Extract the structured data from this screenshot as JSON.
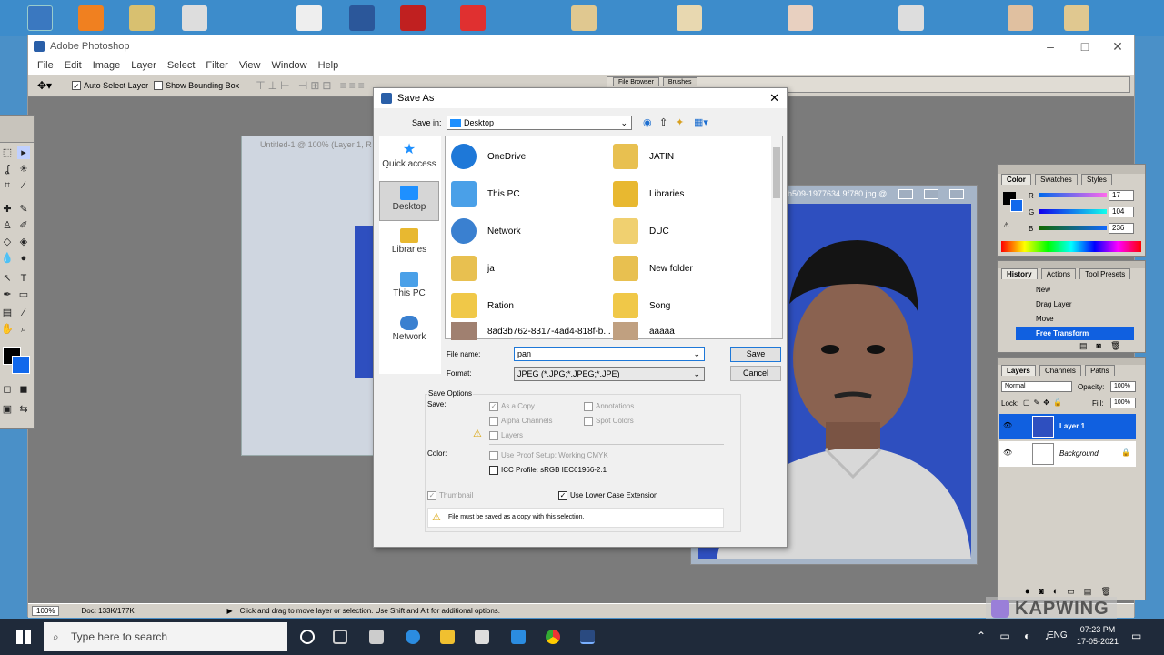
{
  "photoshop": {
    "title": "Adobe Photoshop",
    "menus": [
      "File",
      "Edit",
      "Image",
      "Layer",
      "Select",
      "Filter",
      "View",
      "Window",
      "Help"
    ],
    "options": {
      "auto_select": "Auto Select Layer",
      "bounding_box": "Show Bounding Box"
    },
    "palette_tabs": [
      "File Browser",
      "Brushes"
    ],
    "doc_untitled_title": "Untitled-1 @ 100% (Layer 1, R",
    "doc_photo_title": "b509-1977634 9f780.jpg @",
    "status": {
      "zoom": "100%",
      "doc": "Doc: 133K/177K",
      "hint": "Click and drag to move layer or selection.  Use Shift and Alt for additional options."
    }
  },
  "color_panel": {
    "tabs": [
      "Color",
      "Swatches",
      "Styles"
    ],
    "r_label": "R",
    "g_label": "G",
    "b_label": "B",
    "r": "17",
    "g": "104",
    "b": "236"
  },
  "history_panel": {
    "tabs": [
      "History",
      "Actions",
      "Tool Presets"
    ],
    "items": [
      "New",
      "Drag Layer",
      "Move",
      "Free Transform"
    ]
  },
  "layers_panel": {
    "tabs": [
      "Layers",
      "Channels",
      "Paths"
    ],
    "blend": "Normal",
    "opacity_label": "Opacity:",
    "opacity": "100%",
    "lock_label": "Lock:",
    "fill_label": "Fill:",
    "fill": "100%",
    "layers": [
      "Layer 1",
      "Background"
    ]
  },
  "save_dialog": {
    "title": "Save As",
    "save_in_label": "Save in:",
    "save_in_value": "Desktop",
    "places": [
      "Quick access",
      "Desktop",
      "Libraries",
      "This PC",
      "Network"
    ],
    "files_left": [
      "OneDrive",
      "This PC",
      "Network",
      "ja",
      "Ration",
      "8ad3b762-8317-4ad4-818f-b..."
    ],
    "files_right": [
      "JATIN",
      "Libraries",
      "DUC",
      "New folder",
      "Song",
      "aaaaa"
    ],
    "file_name_label": "File name:",
    "file_name": "pan",
    "format_label": "Format:",
    "format": "JPEG (*.JPG;*.JPEG;*.JPE)",
    "save_btn": "Save",
    "cancel_btn": "Cancel",
    "save_options": "Save Options",
    "save_label": "Save:",
    "as_copy": "As a Copy",
    "annotations": "Annotations",
    "alpha": "Alpha Channels",
    "spot": "Spot Colors",
    "layers": "Layers",
    "color_label": "Color:",
    "proof": "Use Proof Setup:  Working CMYK",
    "icc": "ICC Profile:  sRGB IEC61966-2.1",
    "thumbnail": "Thumbnail",
    "lowercase": "Use Lower Case Extension",
    "warning": "File must be saved as a copy with this selection."
  },
  "taskbar": {
    "search": "Type here to search",
    "lang": "ENG",
    "time": "07:23 PM",
    "date": "17-05-2021"
  },
  "watermark": "KAPWING"
}
